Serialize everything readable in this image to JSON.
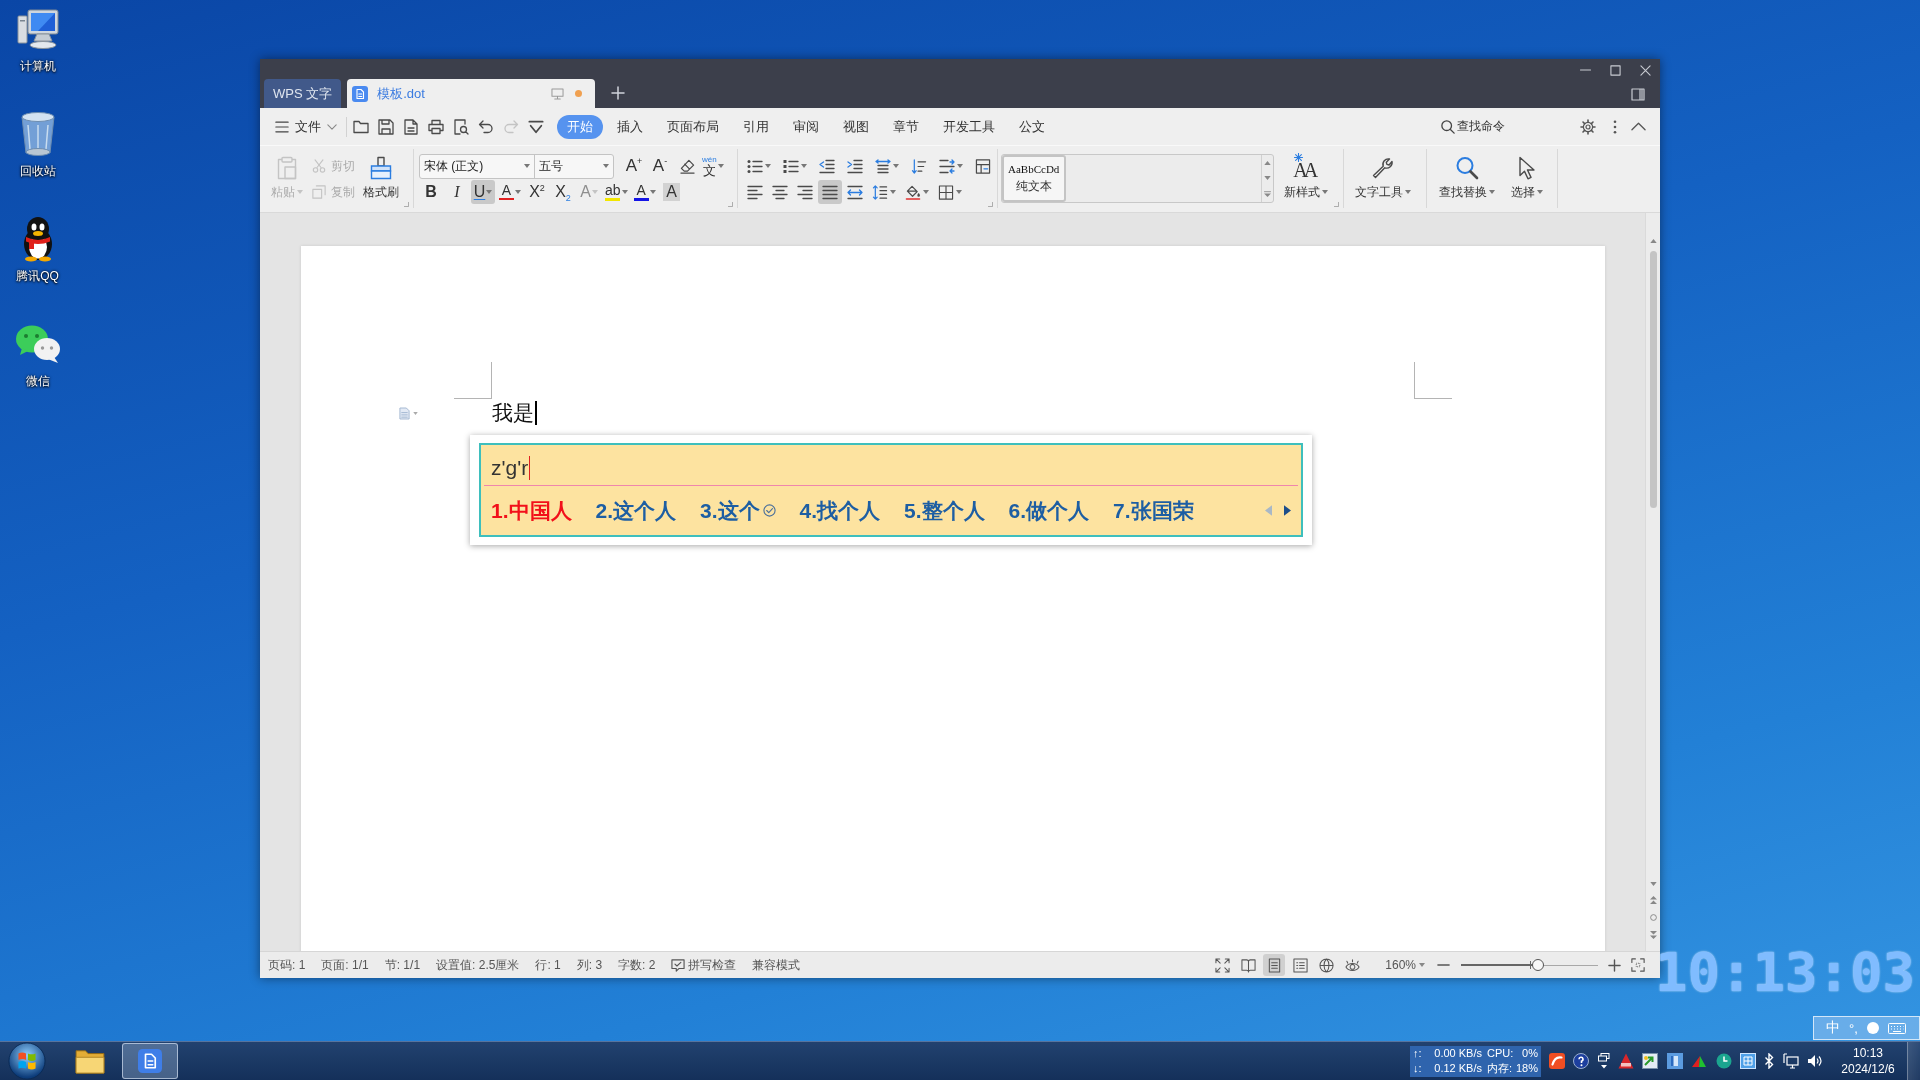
{
  "desktop": {
    "icons": [
      {
        "kind": "computer",
        "label": "计算机"
      },
      {
        "kind": "recycle_bin",
        "label": "回收站"
      },
      {
        "kind": "qq",
        "label": "腾讯QQ"
      },
      {
        "kind": "wechat",
        "label": "微信"
      }
    ],
    "clock_widget": "10:13:03"
  },
  "window": {
    "tabs": [
      {
        "kind": "home",
        "label": "WPS 文字",
        "selected": false,
        "modified": false
      },
      {
        "kind": "document",
        "label": "模板.dot",
        "selected": true,
        "modified": true
      }
    ],
    "menu": {
      "file": "文件",
      "quick_access": [
        {
          "kind": "open",
          "disabled": false
        },
        {
          "kind": "save",
          "disabled": false
        },
        {
          "kind": "pdf",
          "disabled": false
        },
        {
          "kind": "print",
          "disabled": false
        },
        {
          "kind": "preview",
          "disabled": false
        },
        {
          "kind": "undo",
          "disabled": false
        },
        {
          "kind": "redo",
          "disabled": true
        },
        {
          "kind": "customize",
          "disabled": false
        }
      ],
      "tabs": [
        {
          "label": "开始",
          "selected": true
        },
        {
          "label": "插入",
          "selected": false
        },
        {
          "label": "页面布局",
          "selected": false
        },
        {
          "label": "引用",
          "selected": false
        },
        {
          "label": "审阅",
          "selected": false
        },
        {
          "label": "视图",
          "selected": false
        },
        {
          "label": "章节",
          "selected": false
        },
        {
          "label": "开发工具",
          "selected": false
        },
        {
          "label": "公文",
          "selected": false
        }
      ],
      "command_search": "查找命令"
    },
    "ribbon": {
      "clipboard": [
        {
          "kind": "paste",
          "label": "粘贴",
          "disabled": true
        },
        {
          "kind": "cut",
          "label": "剪切",
          "disabled": true
        },
        {
          "kind": "copy",
          "label": "复制",
          "disabled": true
        },
        {
          "kind": "format_painter",
          "label": "格式刷",
          "disabled": false
        }
      ],
      "font_name": "宋体 (正文)",
      "font_size": "五号",
      "font_size_tools": [
        {
          "kind": "grow",
          "glyph": "A$^{+}$"
        },
        {
          "kind": "shrink",
          "glyph": "A$^{-}$"
        },
        {
          "kind": "clear"
        },
        {
          "kind": "phonetic",
          "glyph": "文",
          "ruby": "wén"
        }
      ],
      "font_format": [
        {
          "kind": "bold",
          "glyph": "B",
          "pressed": false,
          "disabled": false
        },
        {
          "kind": "italic",
          "glyph": "I",
          "pressed": false,
          "disabled": false
        },
        {
          "kind": "underline",
          "glyph": "U",
          "pressed": true,
          "disabled": false
        },
        {
          "kind": "strikethrough",
          "glyph": "A",
          "pressed": false,
          "disabled": false
        },
        {
          "kind": "superscript",
          "glyph": "X$^{2}$",
          "pressed": false,
          "disabled": false
        },
        {
          "kind": "subscript",
          "glyph": "X$_{2}$",
          "pressed": false,
          "disabled": false
        },
        {
          "kind": "text_effect",
          "glyph": "A",
          "pressed": false,
          "disabled": true
        },
        {
          "kind": "highlight",
          "glyph": "ab",
          "pressed": false,
          "disabled": false
        },
        {
          "kind": "font_color",
          "glyph": "A",
          "pressed": false,
          "disabled": false
        },
        {
          "kind": "char_shading",
          "glyph": "A",
          "pressed": false,
          "disabled": false
        }
      ],
      "paragraph_rows": [
        [
          {
            "kind": "bullets",
            "pressed": false
          },
          {
            "kind": "numbering",
            "pressed": false
          },
          {
            "kind": "outdent",
            "pressed": false
          },
          {
            "kind": "indent",
            "pressed": false
          },
          {
            "kind": "text_direction",
            "pressed": false
          },
          {
            "kind": "sort",
            "pressed": false
          },
          {
            "kind": "spacing",
            "pressed": false
          },
          {
            "kind": "table",
            "pressed": false
          }
        ],
        [
          {
            "kind": "align_left",
            "pressed": false
          },
          {
            "kind": "center",
            "pressed": false
          },
          {
            "kind": "align_right",
            "pressed": false
          },
          {
            "kind": "justify",
            "pressed": true
          },
          {
            "kind": "distribute",
            "pressed": false
          },
          {
            "kind": "line_spacing",
            "pressed": false
          },
          {
            "kind": "fill",
            "pressed": false
          },
          {
            "kind": "borders",
            "pressed": false
          }
        ]
      ],
      "styles": [
        {
          "sample": "AaBbCcDd",
          "name": "纯文本"
        }
      ],
      "tools": [
        {
          "kind": "new_style",
          "label": "新样式",
          "glyph": "AA"
        },
        {
          "kind": "text_tools",
          "label": "文字工具"
        },
        {
          "kind": "find_replace",
          "label": "查找替换"
        },
        {
          "kind": "select",
          "label": "选择"
        }
      ]
    },
    "document": {
      "text": "我是"
    },
    "ime": {
      "input": "z'g'r",
      "candidates": [
        {
          "label": "1.中国人",
          "selected": true,
          "marked": false
        },
        {
          "label": "2.这个人",
          "selected": false,
          "marked": false
        },
        {
          "label": "3.这个",
          "selected": false,
          "marked": true
        },
        {
          "label": "4.找个人",
          "selected": false,
          "marked": false
        },
        {
          "label": "5.整个人",
          "selected": false,
          "marked": false
        },
        {
          "label": "6.做个人",
          "selected": false,
          "marked": false
        },
        {
          "label": "7.张国荣",
          "selected": false,
          "marked": false
        }
      ],
      "arrows": [
        {
          "kind": "prev",
          "disabled": true
        },
        {
          "kind": "next",
          "disabled": false
        }
      ]
    },
    "status_bar": {
      "fields": [
        "页码: 1",
        "页面: 1/1",
        "节: 1/1",
        "设置值: 2.5厘米",
        "行: 1",
        "列: 3",
        "字数: 2"
      ],
      "spell_check": "拼写检查",
      "mode": "兼容模式",
      "views": [
        {
          "kind": "full_screen",
          "selected": false
        },
        {
          "kind": "reading",
          "selected": false
        },
        {
          "kind": "page",
          "selected": true
        },
        {
          "kind": "outline",
          "selected": false
        },
        {
          "kind": "web",
          "selected": false
        },
        {
          "kind": "eye_care",
          "selected": false
        }
      ],
      "zoom": "160%",
      "zoom_slider": {
        "level": 0.56
      }
    }
  },
  "ime_bar": {
    "mode": "中",
    "punctuation": "°,"
  },
  "taskbar": {
    "apps": [
      {
        "kind": "explorer",
        "selected": false
      },
      {
        "kind": "wps",
        "selected": true
      }
    ],
    "net_monitor": [
      {
        "arrow": "↑:",
        "speed": "0.00 KB/s",
        "metric": "CPU:",
        "value": "0%"
      },
      {
        "arrow": "↓:",
        "speed": "0.12 KB/s",
        "metric": "内存:",
        "value": "18%"
      }
    ],
    "clock": {
      "time": "10:13",
      "date": "2024/12/6"
    }
  }
}
